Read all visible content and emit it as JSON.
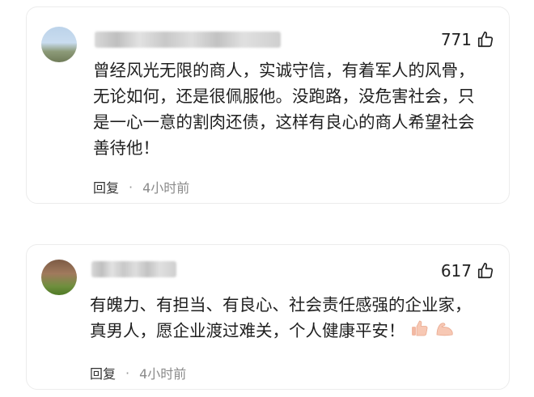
{
  "comments": [
    {
      "likes": "771",
      "lines": [
        "曾经风光无限的商人，实诚守信，有着军人的风骨，",
        "无论如何，还是很佩服他。没跑路，没危害社会，只",
        "是一心一意的割肉还债，这样有良心的商人希望社会",
        "善待他！"
      ],
      "reply_label": "回复",
      "separator": "·",
      "time": "4小时前"
    },
    {
      "likes": "617",
      "lines": [
        "有魄力、有担当、有良心、社会责任感强的企业家，",
        "真男人，愿企业渡过难关，个人健康平安！"
      ],
      "reply_label": "回复",
      "separator": "·",
      "time": "4小时前"
    }
  ],
  "icons": {
    "like": "thumbs-up-icon",
    "emoji_1": "thumbs-up-emoji",
    "emoji_2": "flexed-biceps-emoji"
  },
  "colors": {
    "text": "#1f1f1f",
    "meta": "#8a8a8a",
    "border": "#ececec"
  }
}
